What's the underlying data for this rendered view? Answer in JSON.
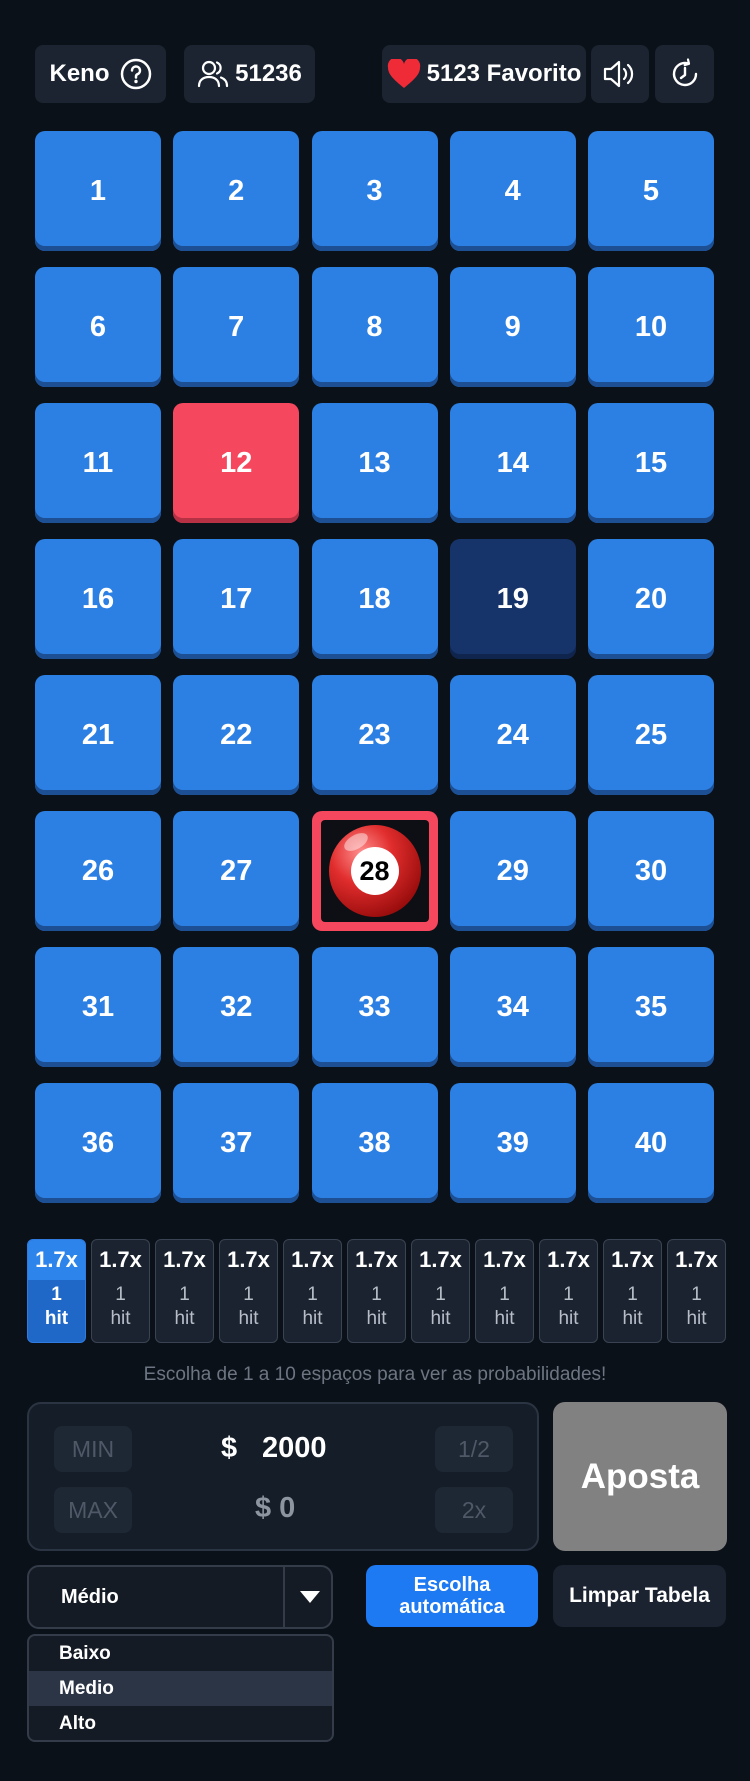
{
  "header": {
    "game_label": "Keno",
    "players_count": "51236",
    "favorite_label": "5123 Favorito"
  },
  "board": {
    "tiles": [
      "1",
      "2",
      "3",
      "4",
      "5",
      "6",
      "7",
      "8",
      "9",
      "10",
      "11",
      "12",
      "13",
      "14",
      "15",
      "16",
      "17",
      "18",
      "19",
      "20",
      "21",
      "22",
      "23",
      "24",
      "25",
      "26",
      "27",
      "28",
      "29",
      "30",
      "31",
      "32",
      "33",
      "34",
      "35",
      "36",
      "37",
      "38",
      "39",
      "40"
    ],
    "selected_red": "12",
    "selected_dark": "19",
    "drawn_ball": "28"
  },
  "payouts": [
    {
      "mult": "1.7x",
      "count": "1",
      "unit": "hit"
    },
    {
      "mult": "1.7x",
      "count": "1",
      "unit": "hit"
    },
    {
      "mult": "1.7x",
      "count": "1",
      "unit": "hit"
    },
    {
      "mult": "1.7x",
      "count": "1",
      "unit": "hit"
    },
    {
      "mult": "1.7x",
      "count": "1",
      "unit": "hit"
    },
    {
      "mult": "1.7x",
      "count": "1",
      "unit": "hit"
    },
    {
      "mult": "1.7x",
      "count": "1",
      "unit": "hit"
    },
    {
      "mult": "1.7x",
      "count": "1",
      "unit": "hit"
    },
    {
      "mult": "1.7x",
      "count": "1",
      "unit": "hit"
    },
    {
      "mult": "1.7x",
      "count": "1",
      "unit": "hit"
    },
    {
      "mult": "1.7x",
      "count": "1",
      "unit": "hit"
    }
  ],
  "hint": "Escolha de 1 a 10 espaços para ver as probabilidades!",
  "bet": {
    "min_label": "MIN",
    "max_label": "MAX",
    "half_label": "1/2",
    "double_label": "2x",
    "currency": "$",
    "amount": "2000",
    "profit": "$ 0",
    "submit_label": "Aposta"
  },
  "risk": {
    "selected": "Médio",
    "options": [
      "Baixo",
      "Medio",
      "Alto"
    ],
    "highlighted_option": "Medio"
  },
  "actions": {
    "auto_label_line1": "Escolha",
    "auto_label_line2": "automática",
    "clear_label": "Limpar Tabela"
  },
  "colors": {
    "background": "#0b1118",
    "tile": "#2c80e4",
    "selected": "#f5475e",
    "accent": "#1e7af2"
  }
}
